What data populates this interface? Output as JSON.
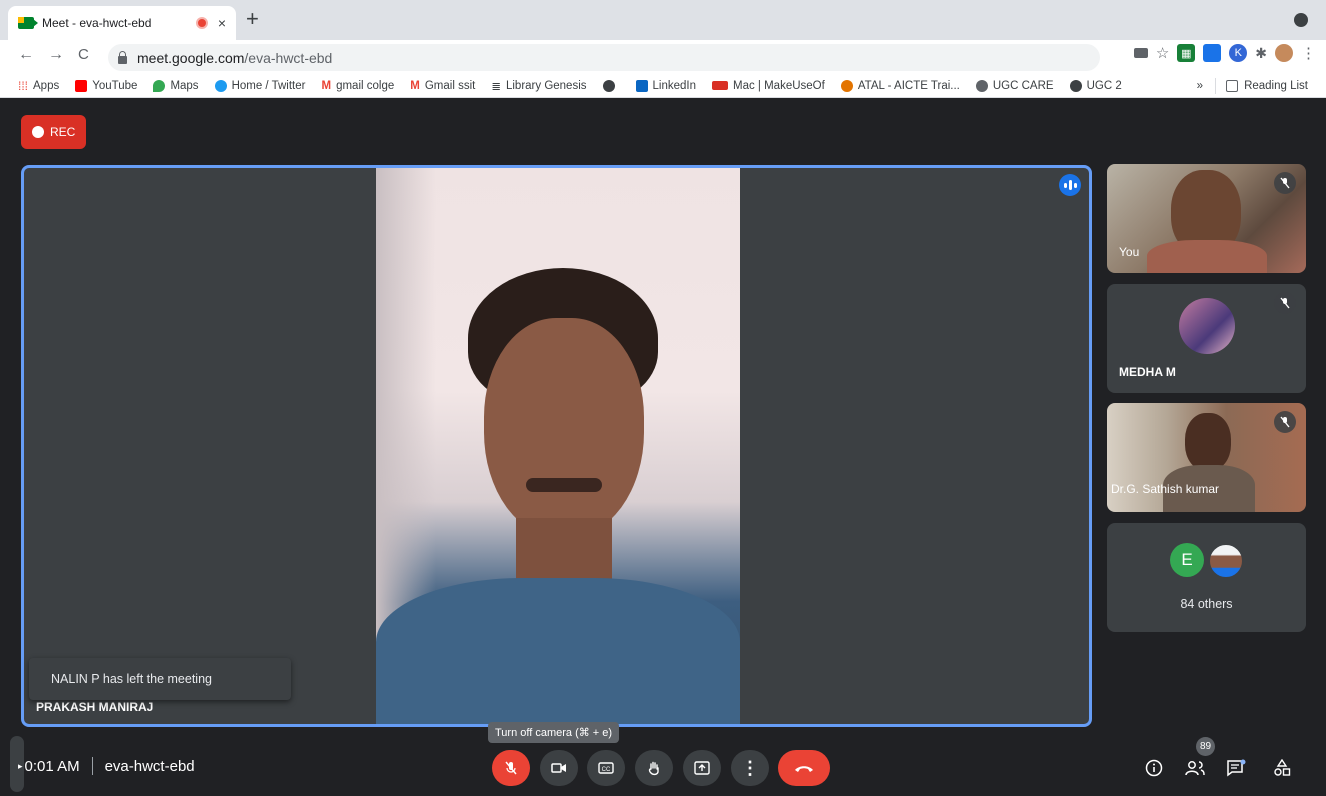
{
  "browser": {
    "tab_title": "Meet - eva-hwct-ebd",
    "tab_close": "×",
    "new_tab": "+",
    "url_host": "meet.google.com",
    "url_path": "/eva-hwct-ebd",
    "nav": {
      "back": "←",
      "forward": "→",
      "reload": "C"
    }
  },
  "bookmarks": {
    "items": [
      {
        "label": "Apps",
        "color": "#ea4335"
      },
      {
        "label": "YouTube",
        "color": "#ff0000"
      },
      {
        "label": "Maps",
        "color": "#34a853"
      },
      {
        "label": "Home / Twitter",
        "color": "#1d9bf0"
      },
      {
        "label": "gmail colge",
        "color": "#ea4335"
      },
      {
        "label": "Gmail ssit",
        "color": "#ea4335"
      },
      {
        "label": "Library Genesis",
        "color": "#3c4043"
      },
      {
        "label": "",
        "color": "#3c4043"
      },
      {
        "label": "LinkedIn",
        "color": "#0a66c2"
      },
      {
        "label": "Mac | MakeUseOf",
        "color": "#d93025"
      },
      {
        "label": "ATAL - AICTE Trai...",
        "color": "#e37400"
      },
      {
        "label": "UGC CARE",
        "color": "#5f6368"
      },
      {
        "label": "UGC 2",
        "color": "#3c4043"
      }
    ],
    "overflow": "»",
    "reading_list": "Reading List"
  },
  "meet": {
    "rec_label": "REC",
    "main_speaker": "PRAKASH MANIRAJ",
    "toast": "NALIN P has left the meeting",
    "participants": [
      {
        "name": "You"
      },
      {
        "name": "MEDHA M"
      },
      {
        "name": "Dr.G. Sathish kumar"
      }
    ],
    "others": {
      "initial": "E",
      "label": "84 others"
    },
    "time": "0:01 AM",
    "meeting_code": "eva-hwct-ebd",
    "tooltip": "Turn off camera (⌘ + e)",
    "people_count": "89"
  },
  "colors": {
    "meet_bg": "#202124",
    "tile_bg": "#3c4043",
    "accent_blue": "#669df6",
    "danger_red": "#ea4335"
  }
}
